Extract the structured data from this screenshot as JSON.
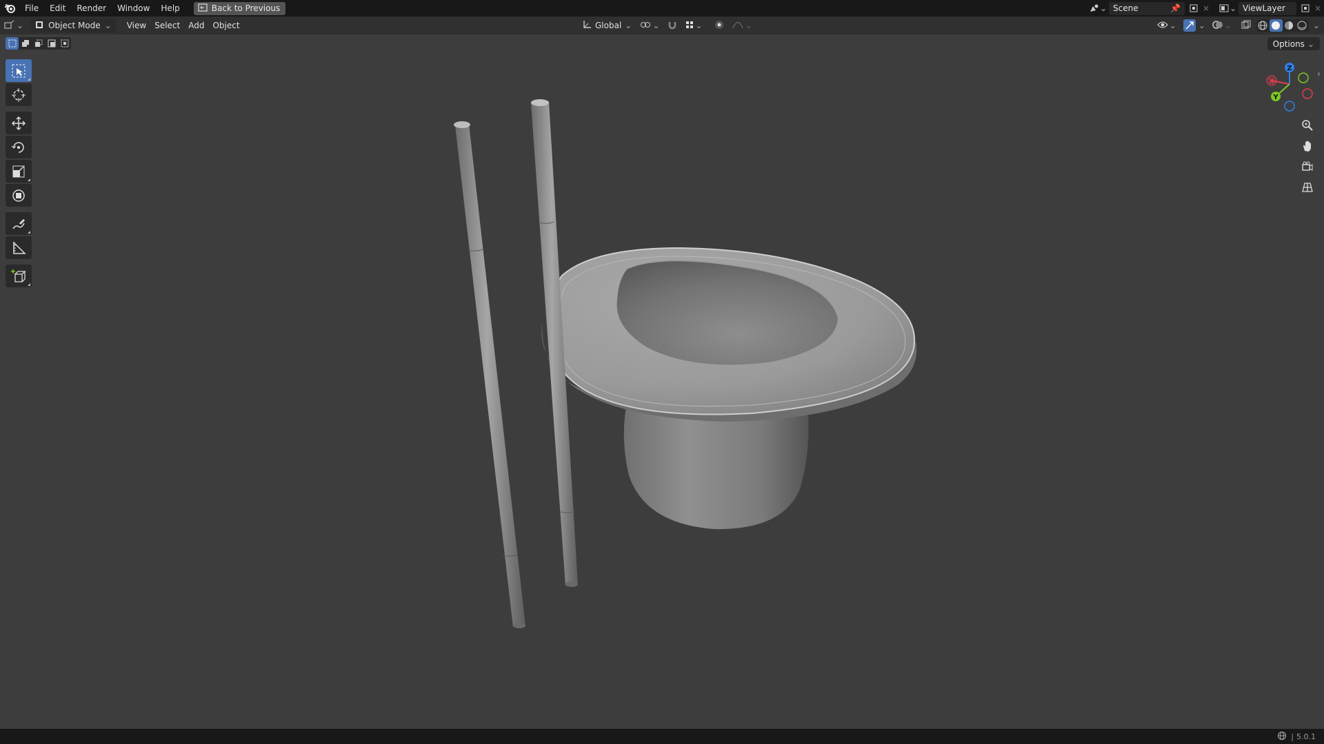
{
  "topbar": {
    "menus": [
      "File",
      "Edit",
      "Render",
      "Window",
      "Help"
    ],
    "back_button": "Back to Previous",
    "scene_name": "Scene",
    "view_layer": "ViewLayer"
  },
  "header": {
    "mode": "Object Mode",
    "menus": [
      "View",
      "Select",
      "Add",
      "Object"
    ],
    "transform_orientation": "Global"
  },
  "options_label": "Options",
  "tools": [
    "select-box",
    "cursor",
    "move",
    "rotate",
    "scale",
    "transform",
    "annotate",
    "measure",
    "add-cube"
  ],
  "gizmo": {
    "x": "X",
    "y": "Y",
    "z": "Z",
    "colors": {
      "x": "#e03c4e",
      "y": "#7cc820",
      "z": "#2f7fe6"
    }
  },
  "statusbar": {
    "version": "5.0.1"
  },
  "colors": {
    "accent": "#4772b3",
    "viewport_bg": "#3d3d3d",
    "topbar_bg": "#181818",
    "header_bg": "#303030"
  }
}
